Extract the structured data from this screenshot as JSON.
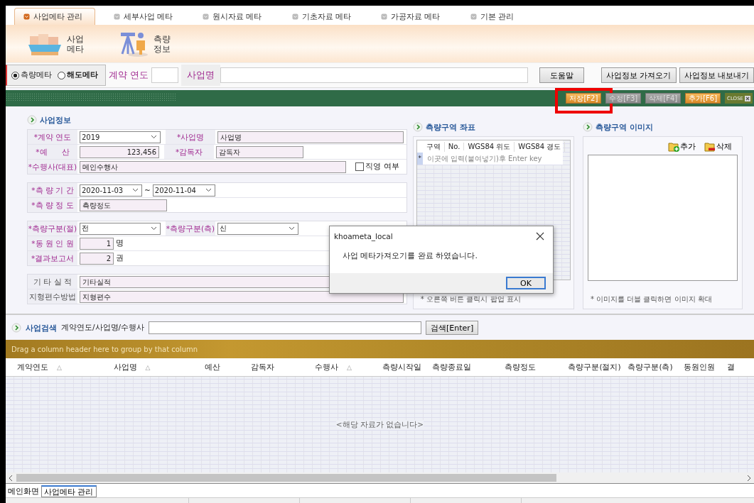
{
  "top_tabs": [
    {
      "label": "사업메타 관리",
      "selected": true
    },
    {
      "label": "세부사업 메타",
      "selected": false
    },
    {
      "label": "원시자료 메타",
      "selected": false
    },
    {
      "label": "기초자료 메타",
      "selected": false
    },
    {
      "label": "가공자료 메타",
      "selected": false
    },
    {
      "label": "기본 관리",
      "selected": false
    }
  ],
  "ribbon": [
    {
      "kind": "ship",
      "lines": [
        "사업",
        "메타"
      ]
    },
    {
      "kind": "survey",
      "lines": [
        "측량",
        "정보"
      ]
    }
  ],
  "filter": {
    "radios": [
      {
        "label": "측량메타",
        "selected": true
      },
      {
        "label": "해도메타",
        "selected": false
      }
    ],
    "year_label": "계약 연도",
    "name_label": "사업명",
    "help_button": "도움말",
    "buttons": [
      "사업정보 가져오기",
      "사업정보 내보내기"
    ]
  },
  "actions": [
    {
      "label": "저장[F2]",
      "disabled": false,
      "highlighted": true
    },
    {
      "label": "수정[F3]",
      "disabled": true,
      "highlighted": false
    },
    {
      "label": "삭제[F4]",
      "disabled": true,
      "highlighted": false
    },
    {
      "label": "추가[F6]",
      "disabled": false,
      "highlighted": false
    }
  ],
  "close_button": "CLOSE",
  "project_info": {
    "title": "사업정보",
    "groups": [
      [
        [
          {
            "kind": "label",
            "text": "*계약 연도",
            "required": true
          },
          {
            "kind": "select",
            "value": "2019"
          },
          {
            "kind": "label",
            "text": "*사업명",
            "required": true
          },
          {
            "kind": "input",
            "value": "사업명",
            "wide": true
          }
        ],
        [
          {
            "kind": "label",
            "text": "*예      산",
            "required": true
          },
          {
            "kind": "number",
            "value": "123,456"
          },
          {
            "kind": "label",
            "text": "*감독자",
            "required": true
          },
          {
            "kind": "input",
            "value": "감독자",
            "wide": false
          }
        ],
        [
          {
            "kind": "label",
            "text": "*수행사(대표)",
            "required": true
          },
          {
            "kind": "input",
            "value": "메인수행사",
            "wide": true
          },
          {
            "kind": "checkbox",
            "text": "직영 여부",
            "checked": false
          }
        ]
      ],
      [
        [
          {
            "kind": "label",
            "text": "*측 량 기 간",
            "required": true
          },
          {
            "kind": "date",
            "value": "2020-11-03"
          },
          {
            "kind": "sep",
            "text": "~"
          },
          {
            "kind": "date",
            "value": "2020-11-04"
          }
        ],
        [
          {
            "kind": "label",
            "text": "*측 량 정 도",
            "required": true
          },
          {
            "kind": "input",
            "value": "측량정도",
            "wide": false
          }
        ]
      ],
      [
        [
          {
            "kind": "label",
            "text": "*측량구분(절)",
            "required": true
          },
          {
            "kind": "select",
            "value": "전"
          },
          {
            "kind": "label",
            "text": "*측량구분(측)",
            "required": true
          },
          {
            "kind": "select",
            "value": "신"
          }
        ],
        [
          {
            "kind": "label",
            "text": "*동 원 인 원",
            "required": true
          },
          {
            "kind": "short",
            "value": "1"
          },
          {
            "kind": "unit",
            "text": "명"
          }
        ],
        [
          {
            "kind": "label",
            "text": "*결과보고서",
            "required": true
          },
          {
            "kind": "short",
            "value": "2"
          },
          {
            "kind": "unit",
            "text": "권"
          }
        ]
      ],
      [
        [
          {
            "kind": "label",
            "text": "기 타 실 적",
            "required": false
          },
          {
            "kind": "input",
            "value": "기타실적",
            "wide": true
          }
        ],
        [
          {
            "kind": "label",
            "text": "지형편수방법",
            "required": false
          },
          {
            "kind": "input",
            "value": "지형편수",
            "wide": true
          }
        ]
      ]
    ]
  },
  "coordinates": {
    "title": "측량구역 좌표",
    "columns": [
      "구역",
      "No.",
      "WGS84 위도",
      "WGS84 경도"
    ],
    "new_row_marker": "*",
    "new_row_hint": "이곳에 입력(붙여넣기)후 Enter key",
    "note": "* 오른쪽 버튼 클릭시 팝업 표시"
  },
  "images": {
    "title": "측량구역 이미지",
    "add_button": "추가",
    "delete_button": "삭제",
    "note": "* 이미지를 더블 클릭하면 이미지 확대"
  },
  "search": {
    "title": "사업검색",
    "hint": "계약연도/사업명/수행사",
    "button": "검색[Enter]"
  },
  "grid": {
    "group_hint": "Drag a column header here to group by that column",
    "columns": [
      {
        "label": "계약연도",
        "sort": "△"
      },
      {
        "label": "사업명",
        "sort": "△"
      },
      {
        "label": "예산"
      },
      {
        "label": "감독자"
      },
      {
        "label": "수행사",
        "sort": "△"
      },
      {
        "label": "측량시작일"
      },
      {
        "label": "측량종료일"
      },
      {
        "label": "측량정도"
      },
      {
        "label": "측량구분(절지)"
      },
      {
        "label": "측량구분(측)"
      },
      {
        "label": "동원인원"
      },
      {
        "label": "결"
      }
    ],
    "empty_text": "<해당 자료가 없습니다>"
  },
  "bottom_tabs": [
    {
      "label": "메인화면",
      "selected": false
    },
    {
      "label": "사업메타 관리",
      "selected": true
    }
  ],
  "dialog": {
    "title": "khoameta_local",
    "message": "사업 메타가져오기를 완료 하였습니다.",
    "ok_button": "OK"
  }
}
